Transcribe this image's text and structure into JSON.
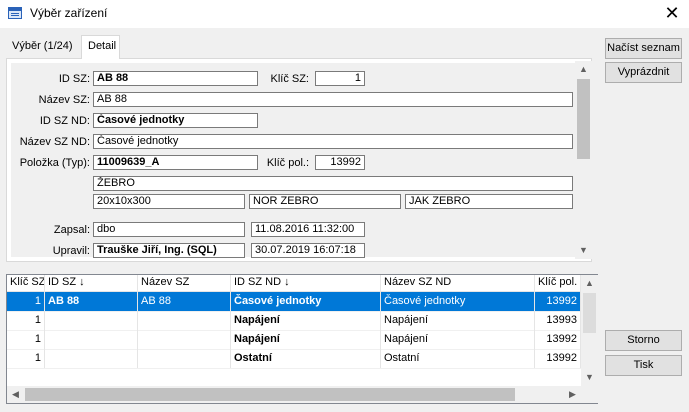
{
  "window": {
    "title": "Výběr zařízení",
    "close_glyph": "✕"
  },
  "tabs": [
    {
      "label": "Výběr (1/24)"
    },
    {
      "label": "Detail"
    }
  ],
  "detail": {
    "labels": {
      "id_sz": "ID SZ:",
      "klic_sz": "Klíč SZ:",
      "nazev_sz": "Název SZ:",
      "id_sz_nd": "ID SZ ND:",
      "nazev_sz_nd": "Název SZ ND:",
      "polozka": "Položka (Typ):",
      "klic_pol": "Klíč pol.:",
      "zapsal": "Zapsal:",
      "upravil": "Upravil:"
    },
    "values": {
      "id_sz": "AB 88",
      "klic_sz": "1",
      "nazev_sz": "AB 88",
      "id_sz_nd": "Časové jednotky",
      "nazev_sz_nd": "Časové jednotky",
      "polozka": "11009639_A",
      "klic_pol": "13992",
      "typ_name": "ŽEBRO",
      "rozmer": "20x10x300",
      "nor": "NOR ZEBRO",
      "jak": "JAK ZEBRO",
      "zapsal_user": "dbo",
      "zapsal_date": "11.08.2016 11:32:00",
      "upravil_user": "Trauške Jiří, Ing. (SQL)",
      "upravil_date": "30.07.2019 16:07:18"
    }
  },
  "grid": {
    "columns": [
      "Klíč SZ",
      "ID SZ ↓",
      "Název SZ",
      "ID SZ ND ↓",
      "Název SZ ND",
      "Klíč pol."
    ],
    "rows": [
      [
        "1",
        "AB 88",
        "AB 88",
        "Časové jednotky",
        "Časové jednotky",
        "13992"
      ],
      [
        "1",
        "",
        "",
        "Napájení",
        "Napájení",
        "13993"
      ],
      [
        "1",
        "",
        "",
        "Napájení",
        "Napájení",
        "13992"
      ],
      [
        "1",
        "",
        "",
        "Ostatní",
        "Ostatní",
        "13992"
      ]
    ]
  },
  "buttons": {
    "nacist": "Načíst seznam",
    "vyprazdnit": "Vyprázdnit",
    "storno": "Storno",
    "tisk": "Tisk"
  },
  "scroll_glyphs": {
    "up": "▲",
    "down": "▼",
    "left": "◀",
    "right": "▶"
  }
}
